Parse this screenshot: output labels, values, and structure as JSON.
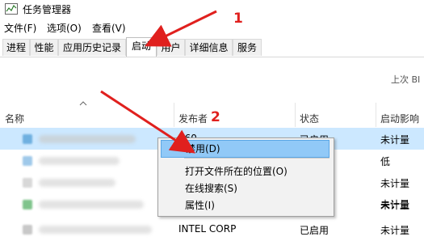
{
  "window": {
    "title": "任务管理器"
  },
  "menu": [
    {
      "label": "文件(F)"
    },
    {
      "label": "选项(O)"
    },
    {
      "label": "查看(V)"
    }
  ],
  "tabs": [
    {
      "label": "进程"
    },
    {
      "label": "性能"
    },
    {
      "label": "应用历史记录"
    },
    {
      "label": "启动",
      "active": true
    },
    {
      "label": "用户"
    },
    {
      "label": "详细信息"
    },
    {
      "label": "服务"
    }
  ],
  "last_boot": {
    "label": "上次 BI"
  },
  "columns": {
    "name": "名称",
    "publisher": "发布者",
    "status": "状态",
    "impact": "启动影响"
  },
  "rows": [
    {
      "publisher": "360",
      "status": "已启用",
      "impact": "未计量",
      "selected": true
    },
    {
      "publisher": "",
      "status": "",
      "impact": "低"
    },
    {
      "publisher": "",
      "status": "",
      "impact": "未计量"
    },
    {
      "publisher": "",
      "status": "",
      "impact": "未计量"
    },
    {
      "publisher": "",
      "status": "",
      "impact": "未计量"
    },
    {
      "publisher": "INTEL CORP",
      "status": "已启用",
      "impact": "未计量"
    }
  ],
  "context_menu": {
    "items": [
      {
        "label": "禁用(D)",
        "highlighted": true
      },
      {
        "label": "打开文件所在的位置(O)"
      },
      {
        "label": "在线搜索(S)"
      },
      {
        "label": "属性(I)"
      }
    ]
  },
  "annotations": {
    "step1": "1",
    "step2": "2"
  },
  "colors": {
    "selection": "#cce8ff",
    "highlight": "#91c9f7",
    "arrow": "#e0201e"
  }
}
